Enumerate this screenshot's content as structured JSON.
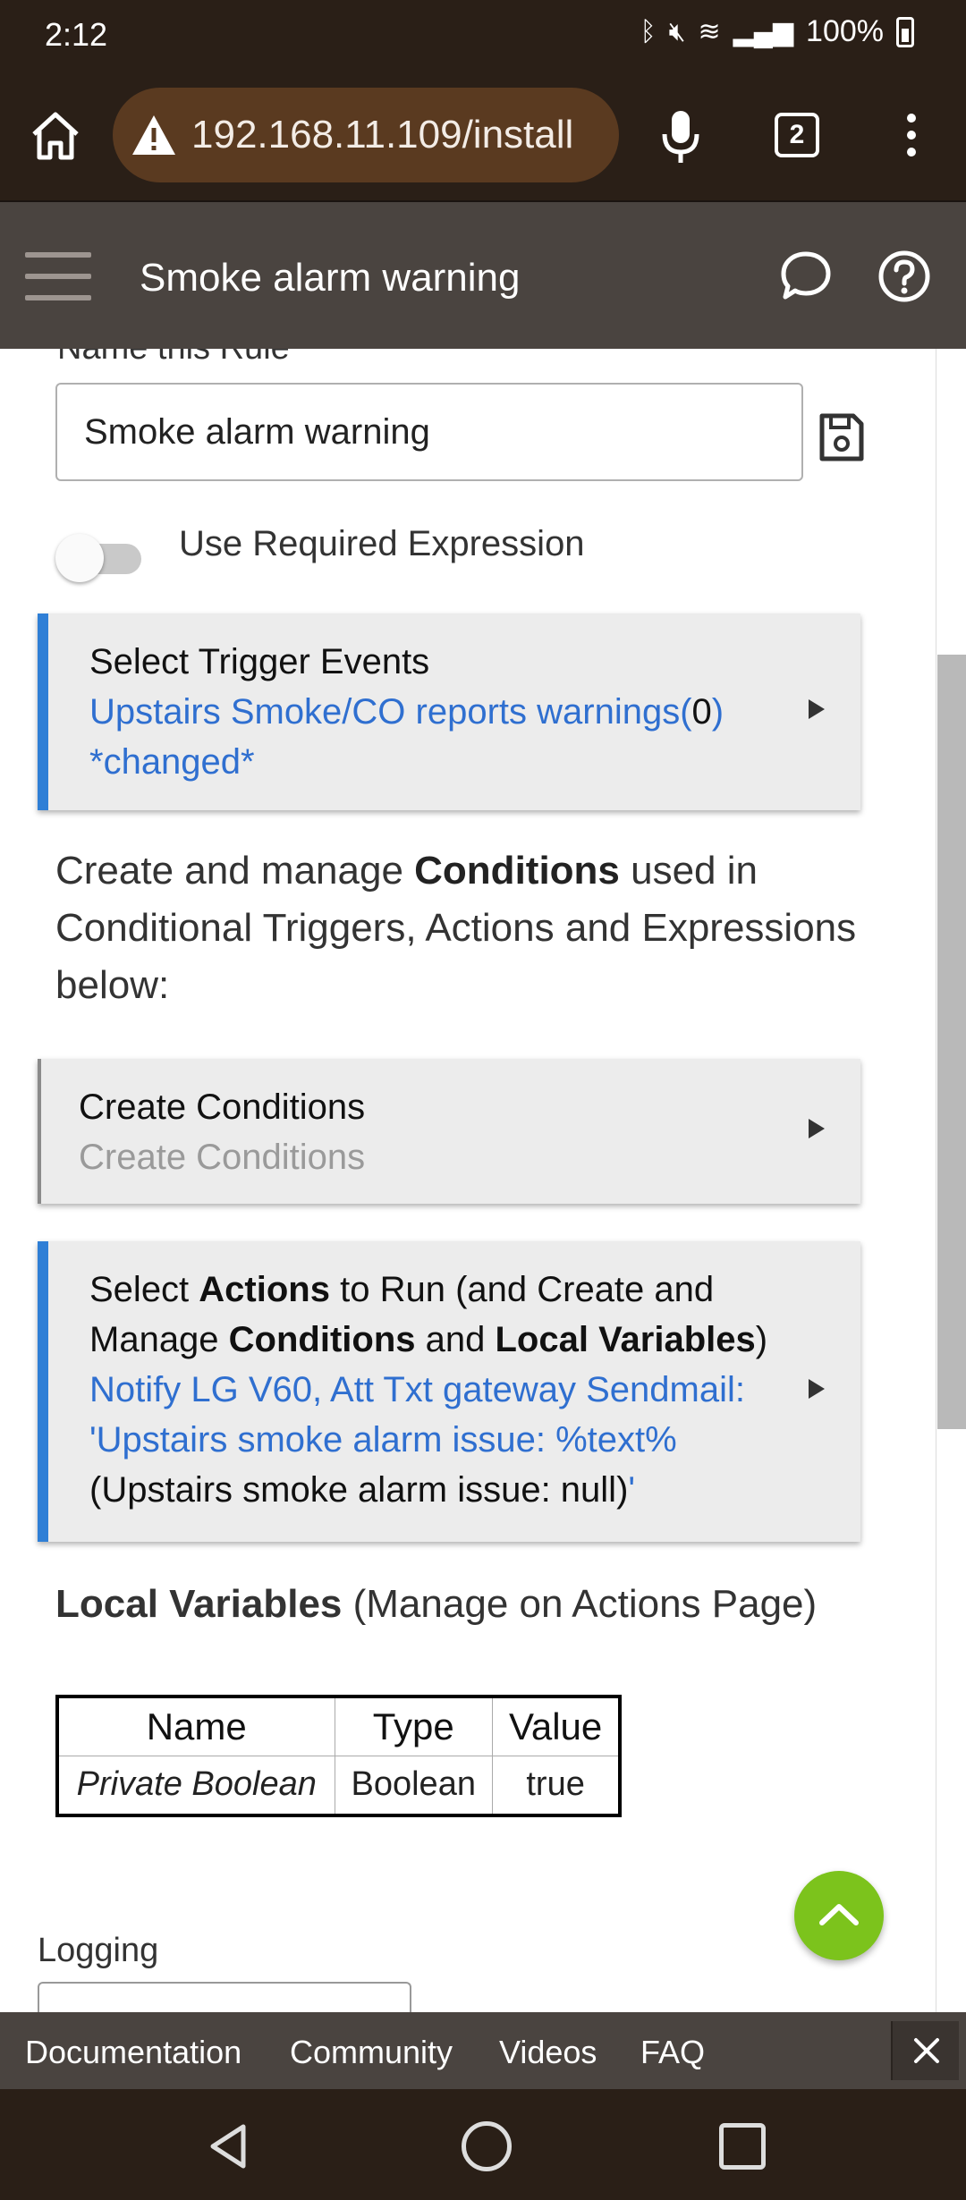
{
  "status_bar": {
    "time": "2:12",
    "battery": "100%"
  },
  "browser": {
    "url": "192.168.11.109/install",
    "tab_count": "2"
  },
  "app_header": {
    "title": "Smoke alarm warning"
  },
  "form": {
    "name_label": "Name this Rule*",
    "name_value": "Smoke alarm warning",
    "toggle_label": "Use Required Expression",
    "toggle_on": false
  },
  "trigger_card": {
    "title": "Select Trigger Events",
    "link_text": "Upstairs Smoke/CO reports warnings(",
    "value_text": "0",
    "link_close": ")",
    "changed_text": "*changed*"
  },
  "conditions_paragraph": {
    "pre": "Create and manage ",
    "bold": "Conditions",
    "post": " used in Conditional Triggers, Actions and Expressions below:"
  },
  "conditions_card": {
    "title": "Create Conditions",
    "subtitle": "Create Conditions"
  },
  "actions_card": {
    "t1": "Select ",
    "b1": "Actions",
    "t2": " to Run (and Create and Manage ",
    "b2": "Conditions",
    "t3": " and ",
    "b3": "Local Variables",
    "t4": ")",
    "link1": "Notify LG V60, Att Txt gateway Sendmail: 'Upstairs smoke alarm issue: %text%",
    "plain": "(Upstairs smoke alarm issue: null)",
    "link2": "'"
  },
  "local_variables": {
    "heading": "Local Variables",
    "subheading": " (Manage on Actions Page)",
    "columns": [
      "Name",
      "Type",
      "Value"
    ],
    "rows": [
      [
        "Private Boolean",
        "Boolean",
        "true"
      ]
    ]
  },
  "logging": {
    "label": "Logging"
  },
  "footer": {
    "links": [
      "Documentation",
      "Community",
      "Videos",
      "FAQ"
    ]
  },
  "colors": {
    "accent_blue": "#2f7fd6",
    "fab_green": "#7cc31c",
    "header": "#4a4440"
  }
}
